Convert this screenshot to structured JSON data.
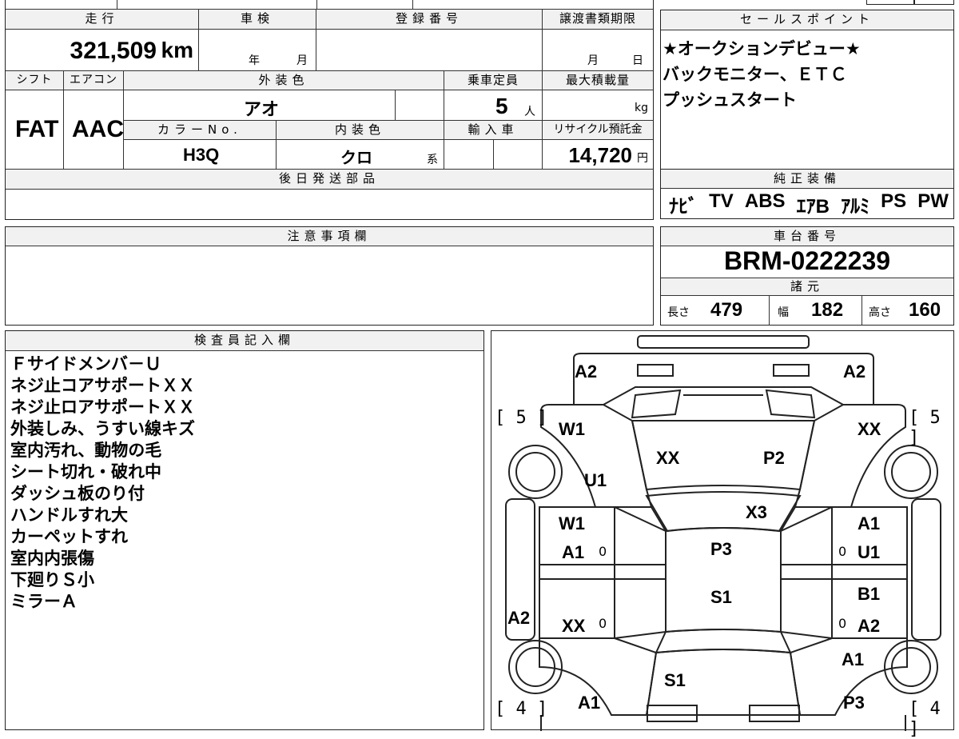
{
  "vehicle": {
    "mileage_header": "走行",
    "mileage_value": "321,509",
    "mileage_unit": "km",
    "shaken_header": "車検",
    "shaken_year_unit": "年",
    "shaken_month_unit": "月",
    "registration_header": "登録番号",
    "transfer_header": "譲渡書類期限",
    "transfer_month_unit": "月",
    "transfer_day_unit": "日",
    "shift_header": "シフト",
    "shift_value": "FAT",
    "aircon_header": "エアコン",
    "aircon_value": "AAC",
    "exterior_header": "外装色",
    "exterior_value": "アオ",
    "capacity_header": "乗車定員",
    "capacity_value": "5",
    "capacity_unit": "人",
    "maxload_header": "最大積載量",
    "maxload_unit": "kg",
    "color_no_header": "カラーNo.",
    "color_no_value": "H3Q",
    "interior_header": "内装色",
    "interior_value": "クロ",
    "interior_unit": "系",
    "import_header": "輸入車",
    "recycle_header": "リサイクル預託金",
    "recycle_value": "14,720",
    "recycle_unit": "円",
    "later_parts_header": "後日発送部品"
  },
  "sales_points": {
    "header": "セールスポイント",
    "lines": [
      "★オークションデビュー★",
      "バックモニター、ＥＴＣ",
      "プッシュスタート"
    ]
  },
  "equipment": {
    "header": "純正装備",
    "items": [
      "ﾅﾋﾞ",
      "TV",
      "ABS",
      "ｴｱB",
      "ｱﾙﾐ",
      "PS",
      "PW"
    ]
  },
  "caution": {
    "header": "注意事項欄"
  },
  "chassis": {
    "header": "車台番号",
    "value": "BRM-0222239"
  },
  "specs": {
    "header": "諸元",
    "length_label": "長さ",
    "length_value": "479",
    "width_label": "幅",
    "width_value": "182",
    "height_label": "高さ",
    "height_value": "160"
  },
  "inspector": {
    "header": "検査員記入欄",
    "lines": [
      "Ｆサイドメンバ－Ｕ",
      "ネジ止コアサポートＸＸ",
      "ネジ止ロアサポートＸＸ",
      "外装しみ、うすい線キズ",
      "室内汚れ、動物の毛",
      "シート切れ・破れ中",
      "ダッシュ板のり付",
      "ハンドルすれ大",
      "カーペットすれ",
      "室内内張傷",
      "下廻りＳ小",
      "ミラーＡ"
    ]
  },
  "diagram": {
    "brackets": {
      "front_left": "[ 5 ]",
      "front_right": "[ 5 ]",
      "rear_left": "[ 4 ]",
      "rear_right": "[ 4 ]"
    },
    "zero_mark": "0",
    "labels": {
      "front_left_corner": "A2",
      "front_right_corner": "A2",
      "left_front_fender": "W1",
      "left_front_fender_2": "U1",
      "right_front_fender": "XX",
      "hood_left": "XX",
      "hood_right": "P2",
      "windshield": "X3",
      "left_front_door_1": "W1",
      "left_front_door_2": "A1",
      "right_front_door_1": "A1",
      "right_front_door_2": "U1",
      "roof": "P3",
      "roof_2": "S1",
      "left_rocker": "A2",
      "left_rear_door": "XX",
      "right_rear_door_1": "B1",
      "right_rear_door_2": "A2",
      "right_rear_fender": "A1",
      "rear_glass": "S1",
      "left_rear_corner": "A1",
      "right_rear_corner": "P3"
    }
  }
}
